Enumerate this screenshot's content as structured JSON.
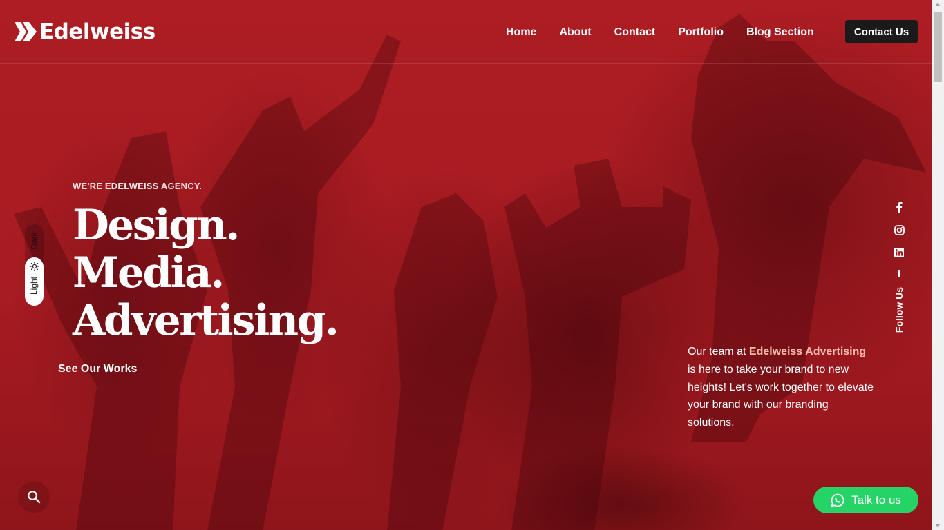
{
  "brand": {
    "name": "Edelweiss",
    "logo_icon": "double-chevron-logo"
  },
  "nav": {
    "items": [
      {
        "label": "Home"
      },
      {
        "label": "About"
      },
      {
        "label": "Contact"
      },
      {
        "label": "Portfolio"
      },
      {
        "label": "Blog Section"
      }
    ],
    "cta_label": "Contact Us"
  },
  "hero": {
    "eyebrow": "WE'RE EDELWEISS AGENCY.",
    "headline_lines": [
      "Design.",
      "Media.",
      "Advertising."
    ],
    "see_works_label": "See Our Works",
    "intro_prefix": "Our team at ",
    "intro_highlight": "Edelweiss Advertising",
    "intro_suffix": " is here to take your brand to new heights! Let's work together to elevate your brand with our branding solutions."
  },
  "social": {
    "icons": [
      "facebook-icon",
      "instagram-icon",
      "linkedin-icon"
    ],
    "follow_label": "Follow Us"
  },
  "theme_toggle": {
    "dark_label": "Dark",
    "light_label": "Light",
    "active": "Light"
  },
  "chat": {
    "label": "Talk to us",
    "icon": "whatsapp-icon"
  },
  "colors": {
    "background": "#a81b22",
    "cta": "#1a1a1a",
    "whatsapp": "#25d366",
    "highlight": "#f7b9a8"
  }
}
